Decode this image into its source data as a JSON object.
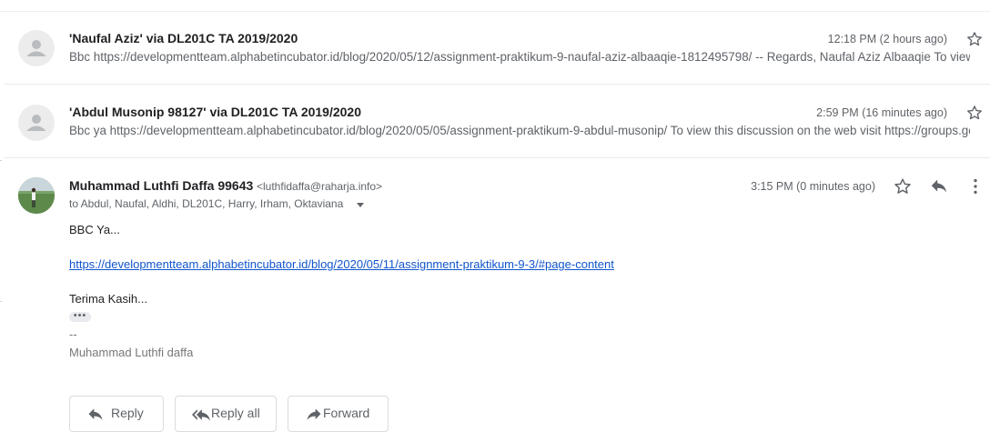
{
  "messages": [
    {
      "sender": "'Naufal Aziz' via DL201C TA 2019/2020",
      "snippet": "Bbc https://developmentteam.alphabetincubator.id/blog/2020/05/12/assignment-praktikum-9-naufal-aziz-albaaqie-1812495798/ -- Regards, Naufal Aziz Albaaqie To view this discussion",
      "time": "12:18 PM (2 hours ago)"
    },
    {
      "sender": "'Abdul Musonip 98127' via DL201C TA 2019/2020",
      "snippet": "Bbc ya https://developmentteam.alphabetincubator.id/blog/2020/05/05/assignment-praktikum-9-abdul-musonip/ To view this discussion on the web visit https://groups.google.com",
      "time": "2:59 PM (16 minutes ago)"
    }
  ],
  "open_message": {
    "sender": "Muhammad Luthfi Daffa 99643",
    "email": "<luthfidaffa@raharja.info>",
    "recipients": "to Abdul, Naufal, Aldhi, DL201C, Harry, Irham, Oktaviana",
    "time": "3:15 PM (0 minutes ago)",
    "greeting": "BBC Ya...",
    "link": "https://developmentteam.alphabetincubator.id/blog/2020/05/11/assignment-praktikum-9-3/#page-content",
    "closing": "Terima Kasih...",
    "ellipsis": "•••",
    "sig_dash": "--",
    "sig_name": "Muhammad Luthfi daffa"
  },
  "actions": {
    "reply": "Reply",
    "reply_all": "Reply all",
    "forward": "Forward"
  },
  "icons": {
    "star": "star-icon",
    "reply": "reply-icon",
    "more": "more-vert-icon",
    "reply_all": "reply-all-icon",
    "forward": "forward-icon"
  }
}
